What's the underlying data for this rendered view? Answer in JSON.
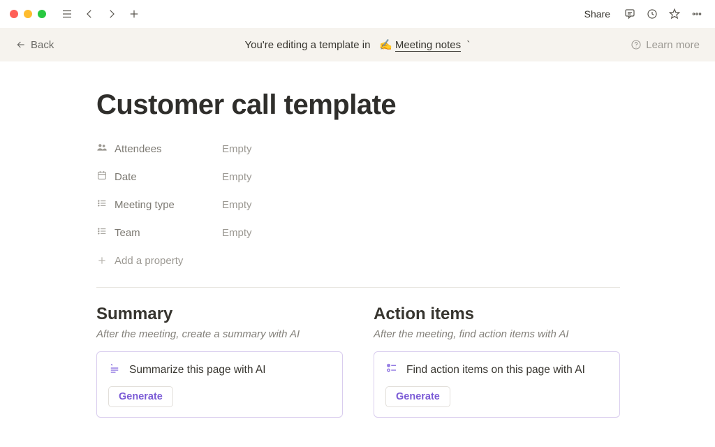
{
  "titlebar": {
    "share_label": "Share"
  },
  "banner": {
    "back_label": "Back",
    "prefix": "You're editing a template in",
    "emoji": "✍️",
    "template_name": "Meeting notes",
    "learn_more": "Learn more"
  },
  "page": {
    "title": "Customer call template"
  },
  "properties": [
    {
      "icon": "people",
      "name": "Attendees",
      "value": "Empty"
    },
    {
      "icon": "calendar",
      "name": "Date",
      "value": "Empty"
    },
    {
      "icon": "list",
      "name": "Meeting type",
      "value": "Empty"
    },
    {
      "icon": "list",
      "name": "Team",
      "value": "Empty"
    }
  ],
  "add_property_label": "Add a property",
  "summary": {
    "heading": "Summary",
    "subtitle": "After the meeting, create a summary with AI",
    "card_text": "Summarize this page with AI",
    "button": "Generate"
  },
  "actions": {
    "heading": "Action items",
    "subtitle": "After the meeting, find action items with AI",
    "card_text": "Find action items on this page with AI",
    "button": "Generate"
  }
}
